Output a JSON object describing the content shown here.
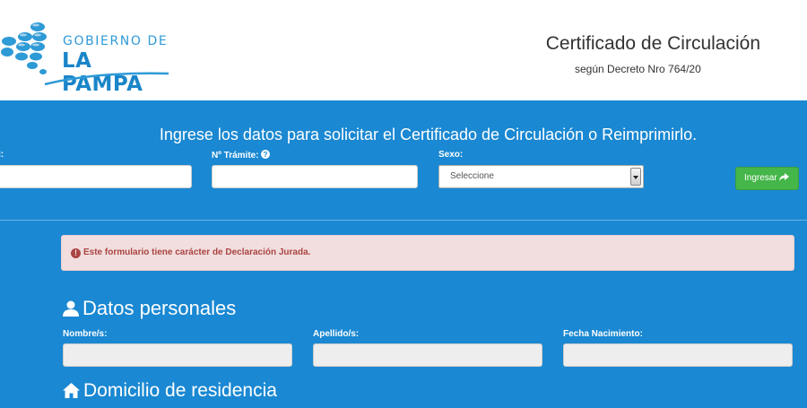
{
  "header": {
    "logo_line1": "GOBIERNO DE",
    "logo_line2": "LA PAMPA",
    "title": "Certificado de Circulación",
    "subtitle": "según Decreto Nro 764/20"
  },
  "search": {
    "heading": "Ingrese los datos para solicitar el Certificado de Circulación o Reimprimirlo.",
    "dni_label": "I:",
    "tramite_label": "Nº Trámite:",
    "sexo_label": "Sexo:",
    "sexo_selected": "Seleccione",
    "submit_label": "Ingresar"
  },
  "alert": {
    "icon": "exclamation-circle-icon",
    "text": "Este formulario tiene carácter de Declaración Jurada."
  },
  "personal": {
    "title": "Datos personales",
    "icon": "user-icon",
    "nombre_label": "Nombre/s:",
    "apellido_label": "Apellido/s:",
    "fecha_label": "Fecha Nacimiento:"
  },
  "domicilio": {
    "title": "Domicilio de residencia",
    "icon": "home-icon"
  },
  "colors": {
    "panel_blue": "#1a88d2",
    "button_green": "#45b649",
    "alert_bg": "#f2dede",
    "alert_text": "#a94442"
  }
}
